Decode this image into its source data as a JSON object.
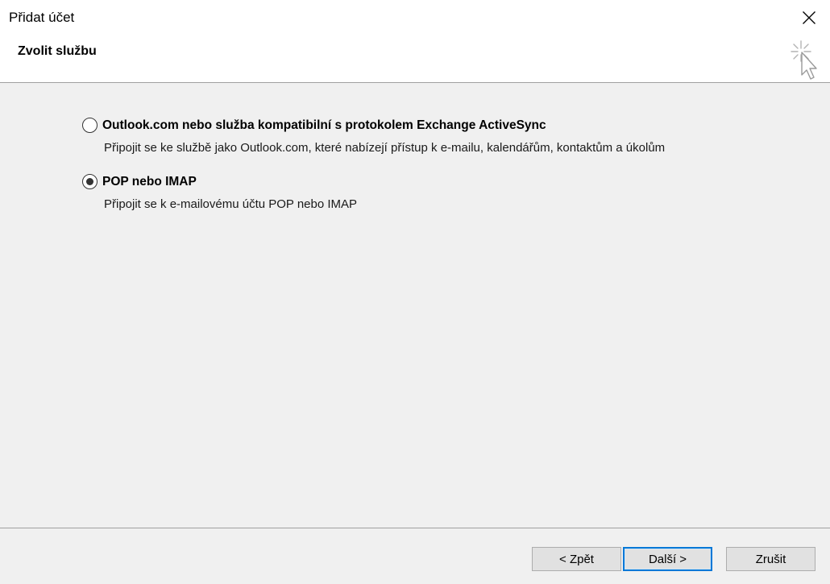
{
  "window": {
    "title": "Přidat účet",
    "subtitle": "Zvolit službu"
  },
  "icons": {
    "close": "close-icon",
    "wizard": "sparkle-cursor-icon"
  },
  "options": [
    {
      "label": "Outlook.com nebo služba kompatibilní s protokolem Exchange ActiveSync",
      "description": "Připojit se ke službě jako Outlook.com, které nabízejí přístup k e-mailu, kalendářům, kontaktům a úkolům",
      "selected": false
    },
    {
      "label": "POP nebo IMAP",
      "description": "Připojit se k e-mailovému účtu POP nebo IMAP",
      "selected": true
    }
  ],
  "buttons": {
    "back": "< Zpět",
    "next": "Další >",
    "cancel": "Zrušit"
  },
  "colors": {
    "header_bg": "#ffffff",
    "body_bg": "#f0f0f0",
    "accent": "#0078d7",
    "button_bg": "#e1e1e1"
  }
}
